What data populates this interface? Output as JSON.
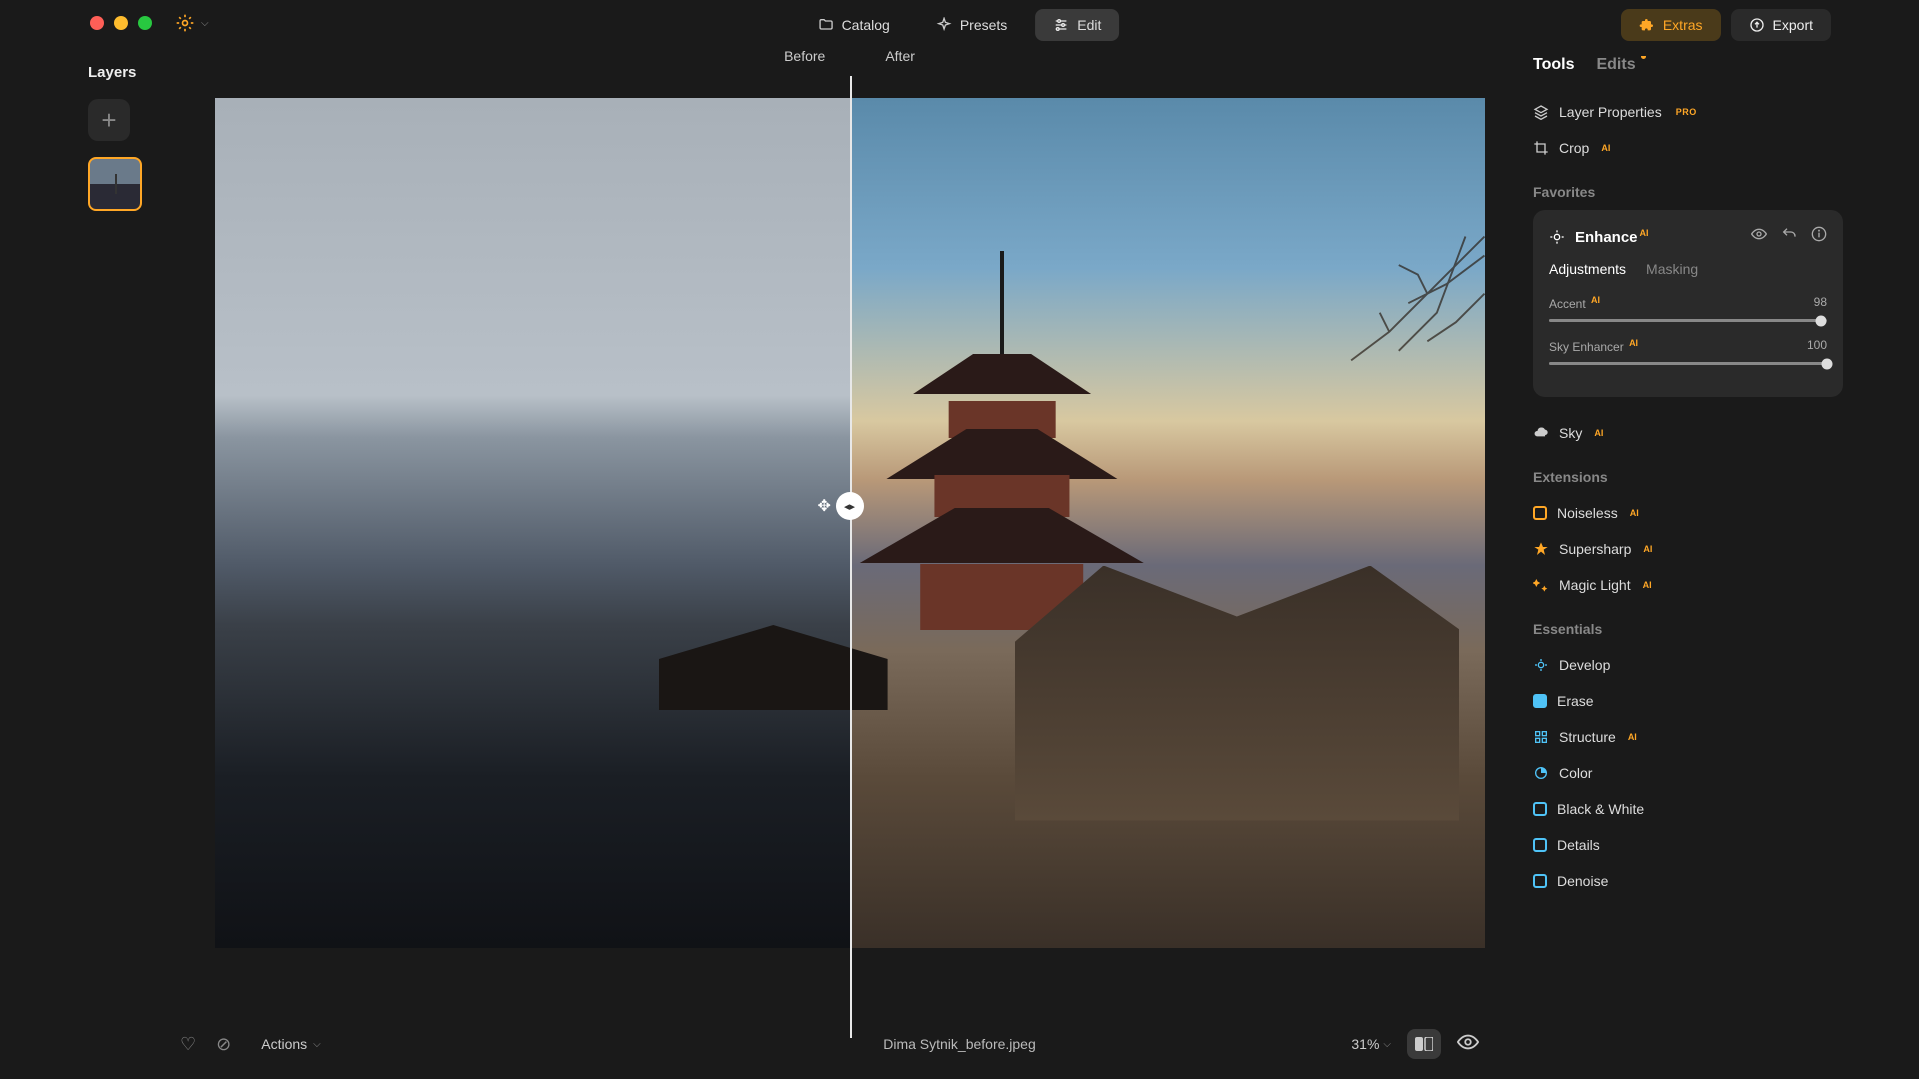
{
  "traffic": {
    "close": "#ff5f57",
    "min": "#febc2e",
    "max": "#28c840"
  },
  "topnav": {
    "catalog": "Catalog",
    "presets": "Presets",
    "edit": "Edit"
  },
  "topright": {
    "extras": "Extras",
    "export": "Export"
  },
  "layers": {
    "title": "Layers"
  },
  "compare": {
    "before": "Before",
    "after": "After"
  },
  "bottombar": {
    "actions": "Actions",
    "filename": "Dima Sytnik_before.jpeg",
    "zoom": "31%"
  },
  "rpanel": {
    "tabs": {
      "tools": "Tools",
      "edits": "Edits"
    },
    "layer_properties": "Layer Properties",
    "crop": "Crop",
    "favorites": "Favorites",
    "enhance": {
      "title": "Enhance",
      "adjustments": "Adjustments",
      "masking": "Masking",
      "accent_label": "Accent",
      "accent_value": "98",
      "sky_enh_label": "Sky Enhancer",
      "sky_enh_value": "100"
    },
    "sky": "Sky",
    "extensions": "Extensions",
    "noiseless": "Noiseless",
    "supersharp": "Supersharp",
    "magiclight": "Magic Light",
    "essentials": "Essentials",
    "develop": "Develop",
    "erase": "Erase",
    "structure": "Structure",
    "color": "Color",
    "bw": "Black & White",
    "details": "Details",
    "denoise": "Denoise",
    "ai": "AI",
    "pro": "PRO"
  }
}
